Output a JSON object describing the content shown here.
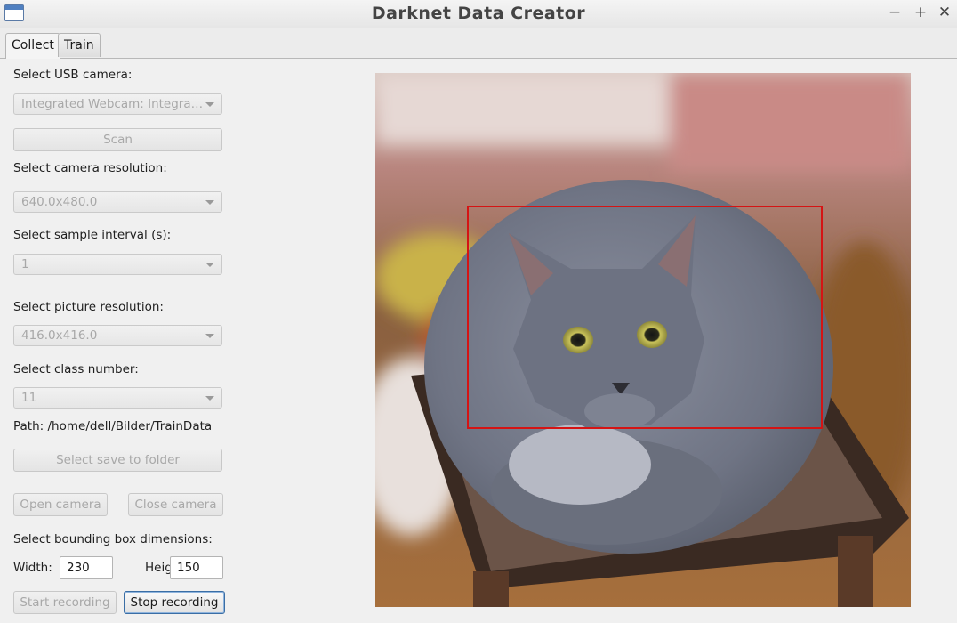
{
  "window": {
    "title": "Darknet Data Creator"
  },
  "tabs": [
    {
      "label": "Collect"
    },
    {
      "label": "Train"
    }
  ],
  "collect": {
    "camera_label": "Select USB camera:",
    "camera_value": "Integrated Webcam: Integrate...",
    "scan_label": "Scan",
    "resolution_label": "Select camera resolution:",
    "resolution_value": "640.0x480.0",
    "interval_label": "Select sample interval (s):",
    "interval_value": "1",
    "picture_res_label": "Select picture resolution:",
    "picture_res_value": "416.0x416.0",
    "class_label": "Select class number:",
    "class_value": "11",
    "path_text": "Path: /home/dell/Bilder/TrainData",
    "save_folder_label": "Select save to folder",
    "open_camera_label": "Open camera",
    "close_camera_label": "Close camera",
    "bbox_label": "Select bounding box dimensions:",
    "width_label": "Width:",
    "width_value": "230",
    "height_label": "Height:",
    "height_value": "150",
    "start_label": "Start recording",
    "stop_label": "Stop recording"
  },
  "colors": {
    "bbox": "#d51414",
    "focus": "#3a6ea5"
  }
}
